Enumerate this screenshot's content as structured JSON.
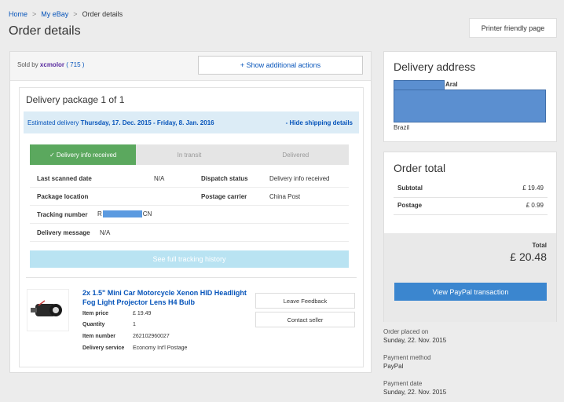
{
  "breadcrumb": {
    "home": "Home",
    "myebay": "My eBay",
    "current": "Order details",
    "sep": ">"
  },
  "page_title": "Order details",
  "printer_button": "Printer friendly page",
  "seller": {
    "sold_by": "Sold by",
    "name": "xcmolor",
    "score": "( 715 )"
  },
  "more_actions": "+ Show additional actions",
  "package": {
    "title": "Delivery package 1 of 1",
    "estimated_prefix": "Estimated delivery",
    "estimated_dates": "Thursday, 17. Dec. 2015 - Friday, 8. Jan. 2016",
    "hide_link": "- Hide shipping details",
    "steps": [
      "✓ Delivery info received",
      "In transit",
      "Delivered"
    ],
    "last_scanned_label": "Last scanned date",
    "last_scanned_value": "N/A",
    "dispatch_label": "Dispatch status",
    "dispatch_value": "Delivery info received",
    "location_label": "Package location",
    "carrier_label": "Postage carrier",
    "carrier_value": "China Post",
    "tracking_label": "Tracking number",
    "tracking_prefix": "R",
    "tracking_suffix": "CN",
    "message_label": "Delivery message",
    "message_value": "N/A",
    "tracking_button": "See full tracking history"
  },
  "item": {
    "title": "2x 1.5\" Mini Car Motorcycle Xenon HID Headlight Fog Light Projector Lens H4 Bulb",
    "price_label": "Item price",
    "price_value": "£ 19.49",
    "qty_label": "Quantity",
    "qty_value": "1",
    "number_label": "Item number",
    "number_value": "262102960027",
    "service_label": "Delivery service",
    "service_value": "Economy Int'l Postage",
    "feedback_button": "Leave Feedback",
    "contact_button": "Contact seller"
  },
  "delivery_address": {
    "title": "Delivery address",
    "name_suffix": "Aral",
    "country": "Brazil"
  },
  "order_total": {
    "title": "Order total",
    "subtotal_label": "Subtotal",
    "subtotal_value": "£ 19.49",
    "postage_label": "Postage",
    "postage_value": "£ 0.99",
    "total_label": "Total",
    "total_value": "£ 20.48",
    "paypal_button": "View PayPal transaction"
  },
  "meta": {
    "placed_label": "Order placed on",
    "placed_value": "Sunday, 22. Nov. 2015",
    "method_label": "Payment method",
    "method_value": "PayPal",
    "date_label": "Payment date",
    "date_value": "Sunday, 22. Nov. 2015"
  }
}
